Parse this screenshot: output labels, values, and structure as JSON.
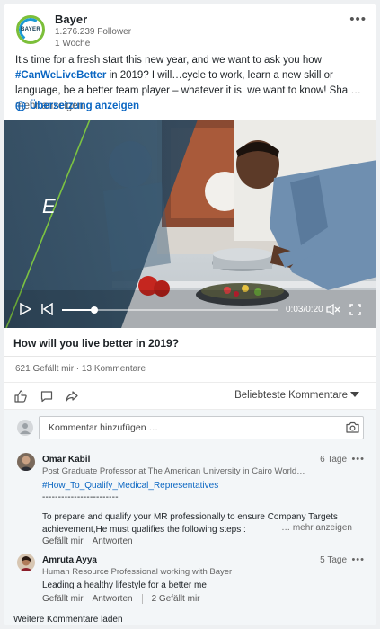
{
  "post": {
    "company": "Bayer",
    "followers": "1.276.239 Follower",
    "age": "1 Woche",
    "more_menu": "•••",
    "text_part1": "It's time for a fresh start this new year, and we want to ask you how",
    "hashtag": "#CanWeLiveBetter",
    "text_part2": " in 2019? I will…cycle to work, learn a new skill or language, be a better team player – whatever it is, we want to know! Sha",
    "ellipsis_more": " … mehr anzeigen",
    "translate": "Übersetzung anzeigen",
    "logo_text": "BAYER"
  },
  "video": {
    "overlay_letter": "E",
    "time": "0:03/0:20",
    "progress": 0.15,
    "title": "How will you live better in 2019?"
  },
  "social": {
    "counts": "621 Gefällt mir · 13 Kommentare",
    "sort_label": "Beliebteste Kommentare"
  },
  "comments": {
    "placeholder": "Kommentar hinzufügen …",
    "items": [
      {
        "name": "Omar Kabil",
        "subtitle": "Post Graduate Professor at The American University in Cairo World…",
        "days": "6 Tage",
        "tag": "#How_To_Qualify_Medical_Representatives",
        "dashes": "------------------------",
        "text": "To prepare and qualify your MR professionally to ensure Company Targets achievement,He must qualifies the following steps :",
        "more": "… mehr anzeigen",
        "like": "Gefällt mir",
        "reply": "Antworten"
      },
      {
        "name": "Amruta Ayya",
        "subtitle": "Human Resource Professional working with Bayer",
        "days": "5 Tage",
        "text": "Leading a healthy lifestyle for a better me",
        "like": "Gefällt mir",
        "reply": "Antworten",
        "like_count": "2 Gefällt mir"
      }
    ],
    "load_more": "Weitere Kommentare laden"
  }
}
